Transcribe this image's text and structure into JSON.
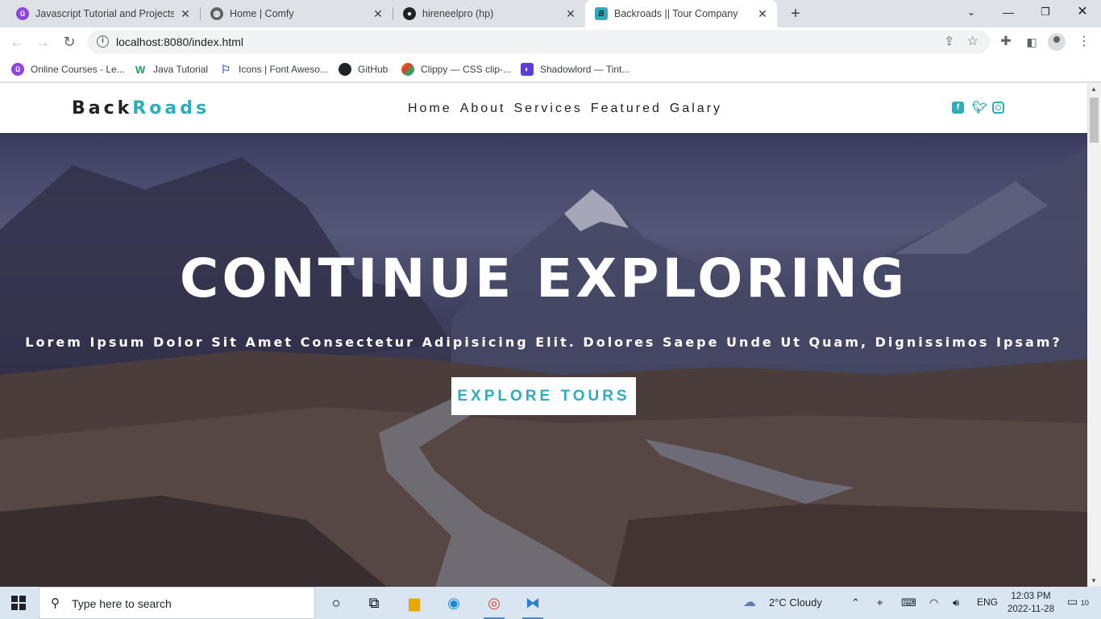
{
  "browser": {
    "tabs": [
      {
        "title": "Javascript Tutorial and Projects C",
        "active": false
      },
      {
        "title": "Home | Comfy",
        "active": false
      },
      {
        "title": "hireneelpro (hp)",
        "active": false
      },
      {
        "title": "Backroads || Tour Company",
        "active": true
      }
    ],
    "url": "localhost:8080/index.html",
    "bookmarks": [
      "Online Courses - Le...",
      "Java Tutorial",
      "Icons | Font Aweso...",
      "GitHub",
      "Clippy — CSS clip-...",
      "Shadowlord — Tint..."
    ]
  },
  "site": {
    "logo_dark": "Back",
    "logo_accent": "Roads",
    "nav": [
      "Home",
      "About",
      "Services",
      "Featured",
      "Galary"
    ],
    "socials": [
      "facebook-icon",
      "twitter-icon",
      "instagram-icon"
    ],
    "hero": {
      "title": "CONTINUE EXPLORING",
      "subtitle": "Lorem Ipsum Dolor Sit Amet Consectetur Adipisicing Elit. Dolores Saepe Unde Ut Quam, Dignissimos Ipsam?",
      "button": "EXPLORE TOURS"
    },
    "accent_color": "#2caeba"
  },
  "taskbar": {
    "search_placeholder": "Type here to search",
    "weather": "2°C  Cloudy",
    "lang": "ENG",
    "time": "12:03 PM",
    "date": "2022-11-28",
    "notifications": "10"
  }
}
